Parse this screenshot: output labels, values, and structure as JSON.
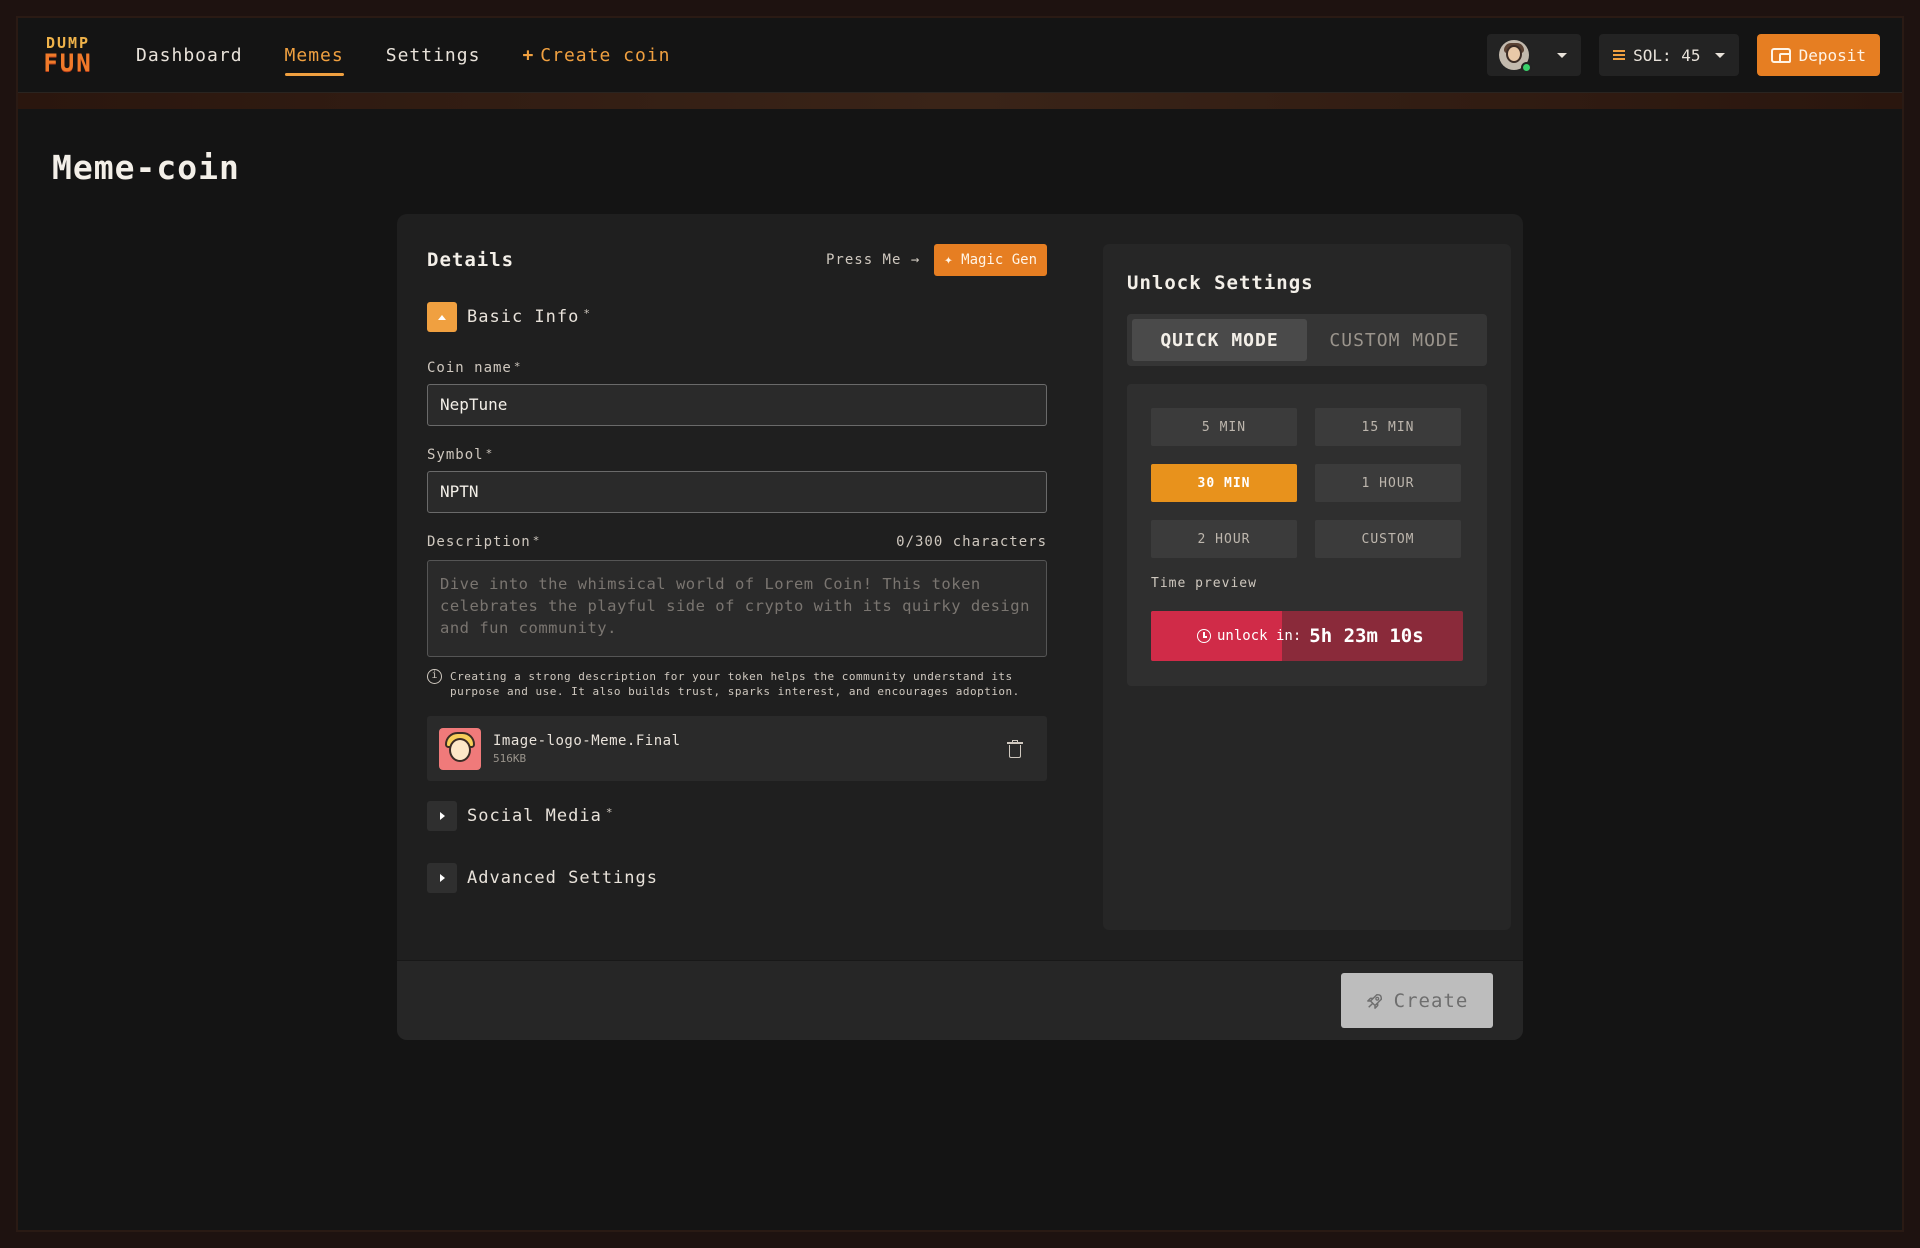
{
  "brand": {
    "line1": "DUMP",
    "line2": "FUN"
  },
  "nav": {
    "items": [
      {
        "label": "Dashboard"
      },
      {
        "label": "Memes",
        "active": true
      },
      {
        "label": "Settings"
      }
    ],
    "create_label": "Create coin",
    "create_plus": "+"
  },
  "header": {
    "sol_label": "SOL: 45",
    "deposit_label": "Deposit",
    "user_online": true
  },
  "page": {
    "title": "Meme-coin"
  },
  "details": {
    "title": "Details",
    "press_me": "Press Me →",
    "magic_gen": "✦ Magic Gen",
    "basic_info": {
      "label": "Basic Info",
      "required": "*",
      "expanded": true
    },
    "coin_name": {
      "label": "Coin name",
      "required": "*",
      "value": "NepTune"
    },
    "symbol": {
      "label": "Symbol",
      "required": "*",
      "value": "NPTN"
    },
    "description": {
      "label": "Description",
      "required": "*",
      "counter": "0/300 characters",
      "placeholder": "Dive into the whimsical world of Lorem Coin! This token celebrates the playful side of crypto with its quirky design and fun community."
    },
    "hint": "Creating a strong description for your token helps the community understand its purpose and use. It also builds trust, sparks interest, and encourages adoption.",
    "file": {
      "name": "Image-logo-Meme.Final",
      "size": "516KB"
    },
    "social_media": {
      "label": "Social Media",
      "required": "*",
      "expanded": false
    },
    "advanced": {
      "label": "Advanced Settings",
      "expanded": false
    }
  },
  "unlock": {
    "title": "Unlock Settings",
    "modes": [
      {
        "label": "QUICK MODE",
        "active": true
      },
      {
        "label": "CUSTOM MODE",
        "active": false
      }
    ],
    "options": [
      {
        "label": "5 MIN"
      },
      {
        "label": "15 MIN"
      },
      {
        "label": "30 MIN",
        "active": true
      },
      {
        "label": "1 HOUR"
      },
      {
        "label": "2 HOUR"
      },
      {
        "label": "CUSTOM"
      }
    ],
    "preview_label": "Time preview",
    "unlock_label": "unlock in:",
    "unlock_time": "5h 23m 10s",
    "progress_fraction": 0.42
  },
  "footer": {
    "create_label": "Create"
  },
  "colors": {
    "accent": "#e67e22",
    "accent_active": "#f0a040",
    "preview_fill": "#d02b48",
    "preview_track": "#8a2a3a"
  }
}
